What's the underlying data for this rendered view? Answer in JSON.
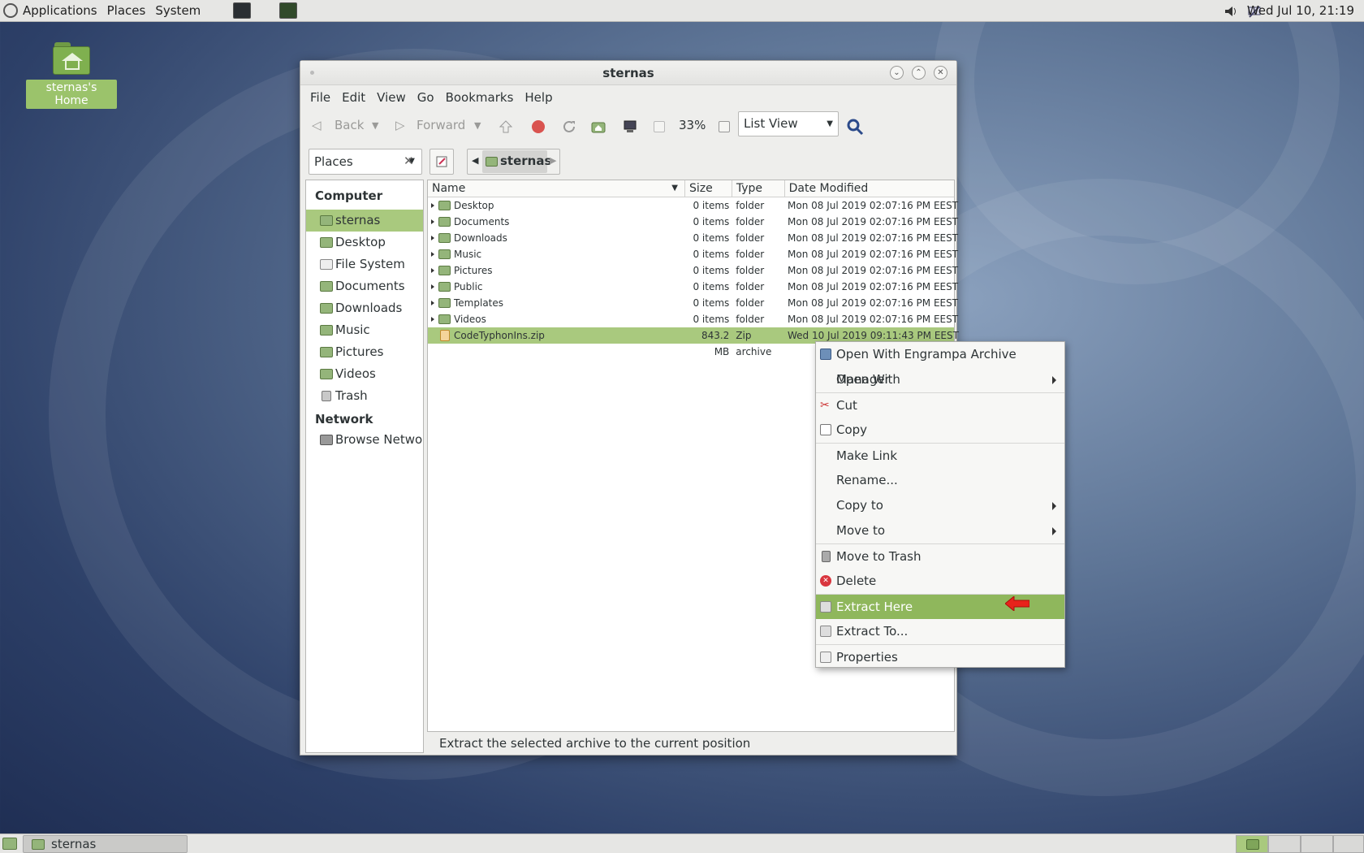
{
  "top_panel": {
    "menus": [
      "Applications",
      "Places",
      "System"
    ],
    "clock": "Wed Jul 10, 21:19"
  },
  "desktop": {
    "home_icon_label": "sternas's Home"
  },
  "window": {
    "title": "sternas",
    "menubar": [
      "File",
      "Edit",
      "View",
      "Go",
      "Bookmarks",
      "Help"
    ],
    "toolbar": {
      "back_label": "Back",
      "forward_label": "Forward",
      "zoom": "33%",
      "view_mode": "List View"
    },
    "sidebar_selector": "Places",
    "breadcrumb": "sternas",
    "sidebar": {
      "computer_header": "Computer",
      "computer_items": [
        "sternas",
        "Desktop",
        "File System",
        "Documents",
        "Downloads",
        "Music",
        "Pictures",
        "Videos",
        "Trash"
      ],
      "network_header": "Network",
      "network_items": [
        "Browse Netwo..."
      ]
    },
    "columns": [
      "Name",
      "Size",
      "Type",
      "Date Modified"
    ],
    "rows": [
      {
        "name": "Desktop",
        "size": "0 items",
        "type": "folder",
        "date": "Mon 08 Jul 2019 02:07:16 PM EEST"
      },
      {
        "name": "Documents",
        "size": "0 items",
        "type": "folder",
        "date": "Mon 08 Jul 2019 02:07:16 PM EEST"
      },
      {
        "name": "Downloads",
        "size": "0 items",
        "type": "folder",
        "date": "Mon 08 Jul 2019 02:07:16 PM EEST"
      },
      {
        "name": "Music",
        "size": "0 items",
        "type": "folder",
        "date": "Mon 08 Jul 2019 02:07:16 PM EEST"
      },
      {
        "name": "Pictures",
        "size": "0 items",
        "type": "folder",
        "date": "Mon 08 Jul 2019 02:07:16 PM EEST"
      },
      {
        "name": "Public",
        "size": "0 items",
        "type": "folder",
        "date": "Mon 08 Jul 2019 02:07:16 PM EEST"
      },
      {
        "name": "Templates",
        "size": "0 items",
        "type": "folder",
        "date": "Mon 08 Jul 2019 02:07:16 PM EEST"
      },
      {
        "name": "Videos",
        "size": "0 items",
        "type": "folder",
        "date": "Mon 08 Jul 2019 02:07:16 PM EEST"
      },
      {
        "name": "CodeTyphonIns.zip",
        "size": "843.2 MB",
        "type": "Zip archive",
        "date": "Wed 10 Jul 2019 09:11:43 PM EEST"
      }
    ],
    "status": "Extract the selected archive to the current position"
  },
  "context_menu": {
    "items": [
      "Open With Engrampa Archive Manager",
      "Open With",
      "Cut",
      "Copy",
      "Make Link",
      "Rename...",
      "Copy to",
      "Move to",
      "Move to Trash",
      "Delete",
      "Extract Here",
      "Extract To...",
      "Properties"
    ],
    "highlighted": "Extract Here"
  },
  "bottom_panel": {
    "task_label": "sternas"
  },
  "colors": {
    "selection": "#a9c97e",
    "menu_highlight": "#8fb75c",
    "annotation_arrow": "#e8231b"
  }
}
